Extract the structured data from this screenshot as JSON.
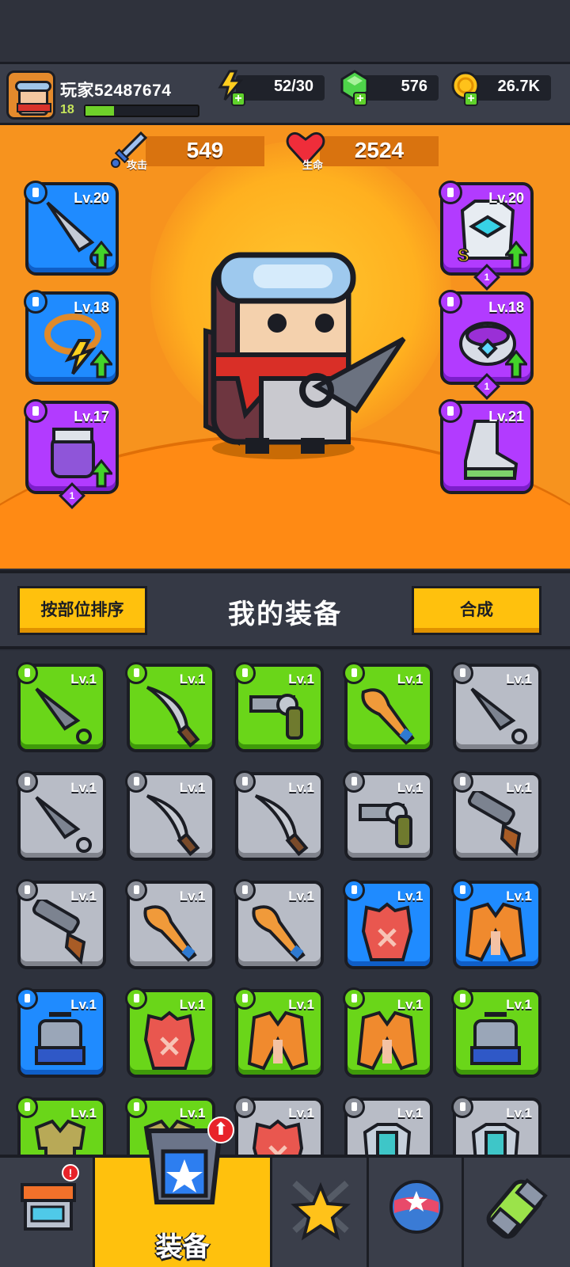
{
  "header": {
    "player_name": "玩家52487674",
    "level": "18",
    "xp_fraction": 0.25,
    "energy": "52/30",
    "gems": "576",
    "gold": "26.7K"
  },
  "stats": {
    "attack_label": "攻击",
    "attack_value": "549",
    "hp_label": "生命",
    "hp_value": "2524"
  },
  "equipped": {
    "left": [
      {
        "level": "Lv.20",
        "rarity": "blue",
        "item": "kunai-icon",
        "upgrade": true
      },
      {
        "level": "Lv.18",
        "rarity": "blue",
        "item": "necklace-icon",
        "upgrade": true
      },
      {
        "level": "Lv.17",
        "rarity": "purple",
        "item": "gauntlet-icon",
        "upgrade": true,
        "star": "1"
      }
    ],
    "right": [
      {
        "level": "Lv.20",
        "rarity": "purple",
        "item": "armor-icon",
        "upgrade": true,
        "star": "1",
        "tag": "S"
      },
      {
        "level": "Lv.18",
        "rarity": "purple",
        "item": "ring-icon",
        "upgrade": true,
        "star": "1"
      },
      {
        "level": "Lv.21",
        "rarity": "purple",
        "item": "boot-icon",
        "upgrade": false
      }
    ]
  },
  "section": {
    "sort_button": "按部位排序",
    "title": "我的装备",
    "merge_button": "合成"
  },
  "inventory": [
    {
      "level": "Lv.1",
      "rarity": "green",
      "item": "kunai-icon"
    },
    {
      "level": "Lv.1",
      "rarity": "green",
      "item": "machete-icon"
    },
    {
      "level": "Lv.1",
      "rarity": "green",
      "item": "revolver-icon"
    },
    {
      "level": "Lv.1",
      "rarity": "green",
      "item": "bat-icon"
    },
    {
      "level": "Lv.1",
      "rarity": "gray",
      "item": "kunai-icon"
    },
    {
      "level": "Lv.1",
      "rarity": "gray",
      "item": "kunai-icon"
    },
    {
      "level": "Lv.1",
      "rarity": "gray",
      "item": "machete-icon"
    },
    {
      "level": "Lv.1",
      "rarity": "gray",
      "item": "machete-icon"
    },
    {
      "level": "Lv.1",
      "rarity": "gray",
      "item": "revolver-icon"
    },
    {
      "level": "Lv.1",
      "rarity": "gray",
      "item": "shotgun-icon"
    },
    {
      "level": "Lv.1",
      "rarity": "gray",
      "item": "shotgun-icon"
    },
    {
      "level": "Lv.1",
      "rarity": "gray",
      "item": "bat-icon"
    },
    {
      "level": "Lv.1",
      "rarity": "gray",
      "item": "bat-icon"
    },
    {
      "level": "Lv.1",
      "rarity": "blue",
      "item": "vest-icon"
    },
    {
      "level": "Lv.1",
      "rarity": "blue",
      "item": "jacket-icon"
    },
    {
      "level": "Lv.1",
      "rarity": "blue",
      "item": "plate-armor-icon"
    },
    {
      "level": "Lv.1",
      "rarity": "green",
      "item": "vest-icon"
    },
    {
      "level": "Lv.1",
      "rarity": "green",
      "item": "jacket-icon"
    },
    {
      "level": "Lv.1",
      "rarity": "green",
      "item": "jacket-icon"
    },
    {
      "level": "Lv.1",
      "rarity": "green",
      "item": "plate-armor-icon"
    },
    {
      "level": "Lv.1",
      "rarity": "green",
      "item": "shirt-icon"
    },
    {
      "level": "Lv.1",
      "rarity": "green",
      "item": "shirt-icon"
    },
    {
      "level": "Lv.1",
      "rarity": "gray",
      "item": "vest-icon"
    },
    {
      "level": "Lv.1",
      "rarity": "gray",
      "item": "chest-armor-icon"
    },
    {
      "level": "Lv.1",
      "rarity": "gray",
      "item": "chest-armor-icon"
    }
  ],
  "nav": {
    "tabs": [
      {
        "name": "shop-icon",
        "label": "",
        "badge": "!"
      },
      {
        "name": "equipment-icon",
        "label": "装备",
        "active": true
      },
      {
        "name": "battle-star-icon",
        "label": ""
      },
      {
        "name": "planet-icon",
        "label": ""
      },
      {
        "name": "dna-capsule-icon",
        "label": ""
      }
    ]
  },
  "colors": {
    "green": "#6ad619",
    "gray": "#b8bcc6",
    "blue": "#1f8bff",
    "purple": "#b23bff",
    "accent": "#ffc10d"
  }
}
